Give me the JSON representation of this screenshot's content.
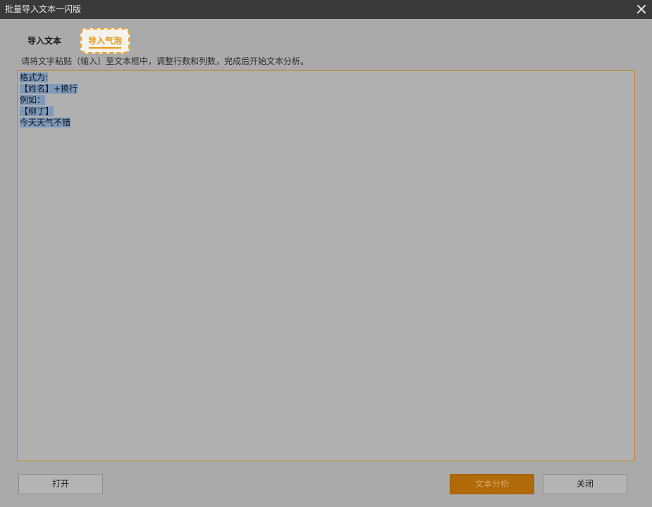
{
  "window": {
    "title": "批量导入文本一闪版"
  },
  "tabs": [
    {
      "label": "导入文本",
      "active": false
    },
    {
      "label": "导入气泡",
      "active": true
    }
  ],
  "instructions": "请将文字粘贴（输入）至文本框中，调整行数和列数，完成后开始文本分析。",
  "editor": {
    "lines": [
      "格式为:",
      "【姓名】+换行",
      "例如：",
      "【柳丁】",
      "今天天气不错"
    ]
  },
  "buttons": {
    "open": "打开",
    "analyze": "文本分析",
    "close": "关闭"
  },
  "colors": {
    "accent": "#e29a16",
    "primary_button": "#b06a09",
    "selection": "#7f99b8",
    "titlebar": "#3a3a3a"
  },
  "icons": {
    "close": "close-icon"
  }
}
